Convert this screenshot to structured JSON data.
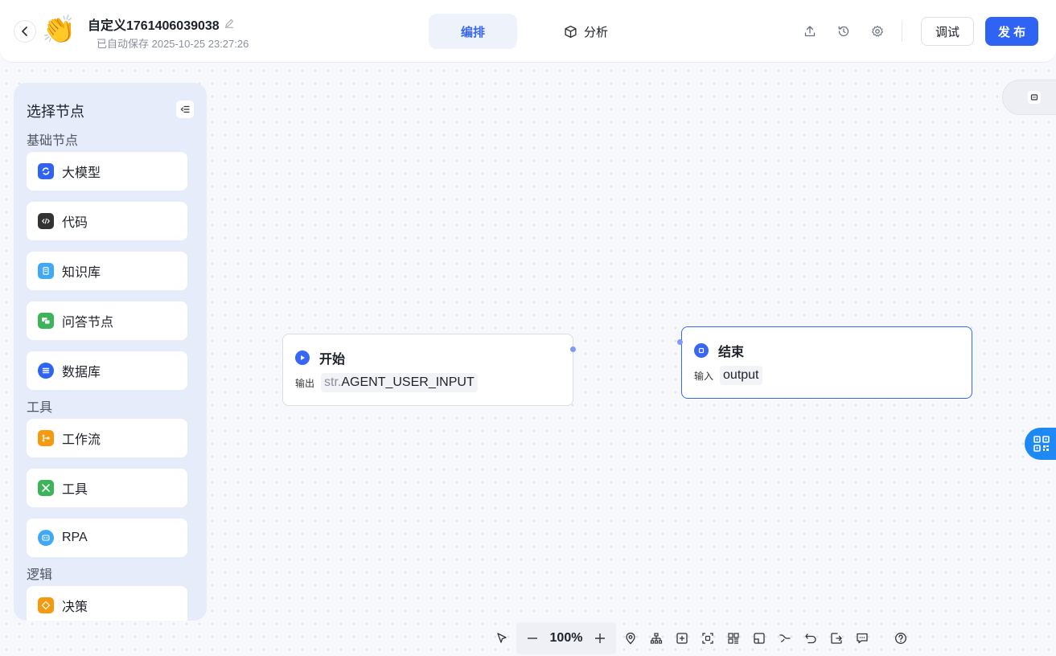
{
  "header": {
    "back_icon": "chevron-left-icon",
    "avatar_emoji": "👏",
    "title": "自定义1761406039038",
    "save_status": "已自动保存 2025-10-25 23:27:26",
    "tabs": [
      {
        "label": "编排",
        "active": true
      },
      {
        "label": "分析",
        "active": false,
        "icon": "cube-icon"
      }
    ],
    "icons": [
      "upload-icon",
      "history-icon",
      "settings-icon"
    ],
    "debug_label": "调试",
    "publish_label": "发 布",
    "accent_color": "#2f63f3"
  },
  "sidebar": {
    "title": "选择节点",
    "sections": [
      {
        "label": "基础节点",
        "items": [
          {
            "label": "大模型",
            "icon": "llm-icon",
            "color": "#2f63f3"
          },
          {
            "label": "代码",
            "icon": "code-icon",
            "color": "#333333"
          },
          {
            "label": "知识库",
            "icon": "knowledge-icon",
            "color": "#3fa9f5"
          },
          {
            "label": "问答节点",
            "icon": "qa-icon",
            "color": "#3cb45a"
          },
          {
            "label": "数据库",
            "icon": "database-icon",
            "color": "#2f63f3"
          }
        ]
      },
      {
        "label": "工具",
        "items": [
          {
            "label": "工作流",
            "icon": "workflow-icon",
            "color": "#f59a0e"
          },
          {
            "label": "工具",
            "icon": "tool-icon",
            "color": "#3cb45a"
          },
          {
            "label": "RPA",
            "icon": "rpa-icon",
            "color": "#3fa9f5"
          }
        ]
      },
      {
        "label": "逻辑",
        "items": [
          {
            "label": "决策",
            "icon": "decision-icon",
            "color": "#f59a0e"
          }
        ]
      }
    ]
  },
  "canvas": {
    "start_node": {
      "title": "开始",
      "row_label": "输出",
      "var_type": "str.",
      "var_name": "AGENT_USER_INPUT"
    },
    "end_node": {
      "title": "结束",
      "row_label": "输入",
      "var_name": "output"
    }
  },
  "toolbar": {
    "zoom": "100%",
    "tools": [
      "pointer-icon",
      "locate-icon",
      "layout-icon",
      "add-node-icon",
      "fit-view-icon",
      "minimap-icon",
      "panel-icon",
      "edge-icon",
      "undo-icon",
      "export-icon",
      "comment-icon",
      "help-icon"
    ]
  }
}
